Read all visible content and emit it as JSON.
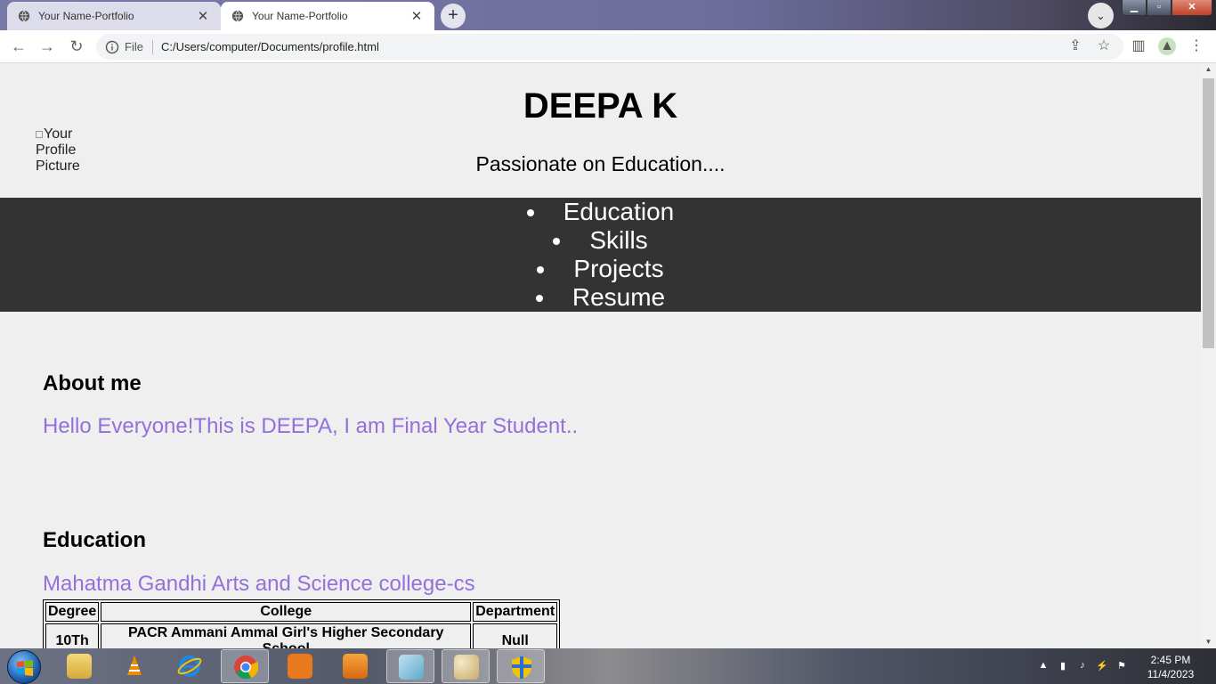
{
  "browser": {
    "tabs": [
      {
        "title": "Your Name-Portfolio",
        "active": false
      },
      {
        "title": "Your Name-Portfolio",
        "active": true
      }
    ],
    "address": {
      "scheme_label": "File",
      "url": "C:/Users/computer/Documents/profile.html"
    }
  },
  "page": {
    "profile_alt": "Your Profile Picture",
    "name": "DEEPA K",
    "tagline": "Passionate on Education....",
    "nav": [
      "Education",
      "Skills",
      "Projects",
      "Resume"
    ],
    "about": {
      "heading": "About me",
      "text": "Hello Everyone!This is DEEPA, I am Final Year Student.."
    },
    "education": {
      "heading": "Education",
      "college": "Mahatma Gandhi Arts and Science college-cs",
      "table": {
        "headers": [
          "Degree",
          "College",
          "Department"
        ],
        "rows": [
          [
            "10Th",
            "PACR Ammani Ammal Girl's Higher Secondary School",
            "Null"
          ]
        ]
      }
    },
    "accent_color": "#9370db",
    "nav_background": "#333333"
  },
  "taskbar": {
    "apps": [
      "windows-explorer",
      "vlc",
      "internet-explorer",
      "chrome",
      "pdf-reader",
      "media-player",
      "notepad",
      "paint",
      "security"
    ],
    "clock_time": "2:45 PM",
    "clock_date": "11/4/2023"
  }
}
